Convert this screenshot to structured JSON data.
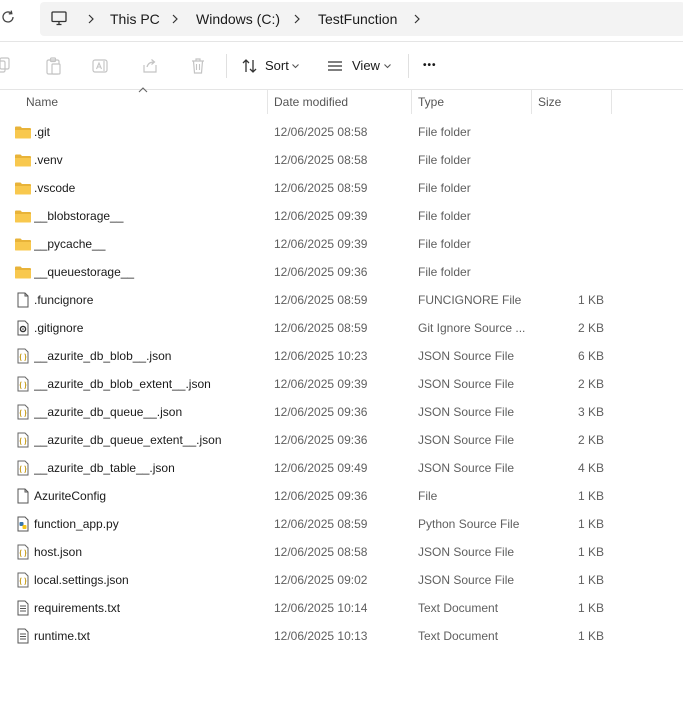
{
  "breadcrumb": {
    "items": [
      "This PC",
      "Windows (C:)",
      "TestFunction"
    ]
  },
  "toolbar": {
    "sort_label": "Sort",
    "view_label": "View",
    "more_label": "•••"
  },
  "columns": {
    "name": "Name",
    "date": "Date modified",
    "type": "Type",
    "size": "Size"
  },
  "colors": {
    "folder": "#F8C84E",
    "folder_dark": "#E8B339",
    "python_blue": "#3776AB",
    "json_yellow": "#C9A227"
  },
  "files": [
    {
      "name": ".git",
      "date": "12/06/2025 08:58",
      "type": "File folder",
      "size": "",
      "icon": "folder-icon"
    },
    {
      "name": ".venv",
      "date": "12/06/2025 08:58",
      "type": "File folder",
      "size": "",
      "icon": "folder-icon"
    },
    {
      "name": ".vscode",
      "date": "12/06/2025 08:59",
      "type": "File folder",
      "size": "",
      "icon": "folder-icon"
    },
    {
      "name": "__blobstorage__",
      "date": "12/06/2025 09:39",
      "type": "File folder",
      "size": "",
      "icon": "folder-icon"
    },
    {
      "name": "__pycache__",
      "date": "12/06/2025 09:39",
      "type": "File folder",
      "size": "",
      "icon": "folder-icon"
    },
    {
      "name": "__queuestorage__",
      "date": "12/06/2025 09:36",
      "type": "File folder",
      "size": "",
      "icon": "folder-icon"
    },
    {
      "name": ".funcignore",
      "date": "12/06/2025 08:59",
      "type": "FUNCIGNORE File",
      "size": "1 KB",
      "icon": "blank-file-icon"
    },
    {
      "name": ".gitignore",
      "date": "12/06/2025 08:59",
      "type": "Git Ignore Source ...",
      "size": "2 KB",
      "icon": "settings-file-icon"
    },
    {
      "name": "__azurite_db_blob__.json",
      "date": "12/06/2025 10:23",
      "type": "JSON Source File",
      "size": "6 KB",
      "icon": "json-file-icon"
    },
    {
      "name": "__azurite_db_blob_extent__.json",
      "date": "12/06/2025 09:39",
      "type": "JSON Source File",
      "size": "2 KB",
      "icon": "json-file-icon"
    },
    {
      "name": "__azurite_db_queue__.json",
      "date": "12/06/2025 09:36",
      "type": "JSON Source File",
      "size": "3 KB",
      "icon": "json-file-icon"
    },
    {
      "name": "__azurite_db_queue_extent__.json",
      "date": "12/06/2025 09:36",
      "type": "JSON Source File",
      "size": "2 KB",
      "icon": "json-file-icon"
    },
    {
      "name": "__azurite_db_table__.json",
      "date": "12/06/2025 09:49",
      "type": "JSON Source File",
      "size": "4 KB",
      "icon": "json-file-icon"
    },
    {
      "name": "AzuriteConfig",
      "date": "12/06/2025 09:36",
      "type": "File",
      "size": "1 KB",
      "icon": "blank-file-icon"
    },
    {
      "name": "function_app.py",
      "date": "12/06/2025 08:59",
      "type": "Python Source File",
      "size": "1 KB",
      "icon": "python-file-icon"
    },
    {
      "name": "host.json",
      "date": "12/06/2025 08:58",
      "type": "JSON Source File",
      "size": "1 KB",
      "icon": "json-file-icon"
    },
    {
      "name": "local.settings.json",
      "date": "12/06/2025 09:02",
      "type": "JSON Source File",
      "size": "1 KB",
      "icon": "json-file-icon"
    },
    {
      "name": "requirements.txt",
      "date": "12/06/2025 10:14",
      "type": "Text Document",
      "size": "1 KB",
      "icon": "text-file-icon"
    },
    {
      "name": "runtime.txt",
      "date": "12/06/2025 10:13",
      "type": "Text Document",
      "size": "1 KB",
      "icon": "text-file-icon"
    }
  ]
}
